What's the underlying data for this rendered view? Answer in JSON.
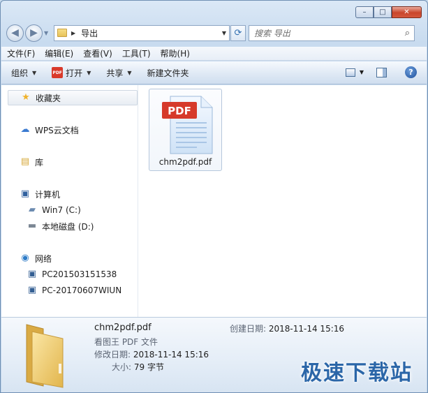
{
  "window": {
    "minimize_glyph": "–",
    "maximize_glyph": "□",
    "close_glyph": "✕"
  },
  "nav": {
    "back_glyph": "◀",
    "forward_glyph": "▶",
    "address_path": "导出",
    "search_placeholder": "搜索 导出"
  },
  "menu": [
    "文件(F)",
    "编辑(E)",
    "查看(V)",
    "工具(T)",
    "帮助(H)"
  ],
  "commands": {
    "organize": "组织",
    "open": "打开",
    "open_icon_text": "PDF",
    "share": "共享",
    "new_folder": "新建文件夹",
    "help": "?"
  },
  "sidebar": {
    "favorites": "收藏夹",
    "wps": "WPS云文档",
    "library": "库",
    "computer": "计算机",
    "drive_c": "Win7 (C:)",
    "drive_d": "本地磁盘 (D:)",
    "network": "网络",
    "net_pc1": "PC201503151538",
    "net_pc2": "PC-20170607WIUN"
  },
  "file": {
    "name": "chm2pdf.pdf",
    "badge": "PDF"
  },
  "details": {
    "name": "chm2pdf.pdf",
    "type": "看图王 PDF 文件",
    "modified_label": "修改日期:",
    "modified_value": "2018-11-14 15:16",
    "size_label": "大小:",
    "size_value": "79 字节",
    "created_label": "创建日期:",
    "created_value": "2018-11-14 15:16"
  },
  "watermark": "极速下载站",
  "colors": {
    "pdf_red": "#d93a2b",
    "accent_blue": "#2b66a8",
    "folder_yellow": "#f1cd6e"
  }
}
